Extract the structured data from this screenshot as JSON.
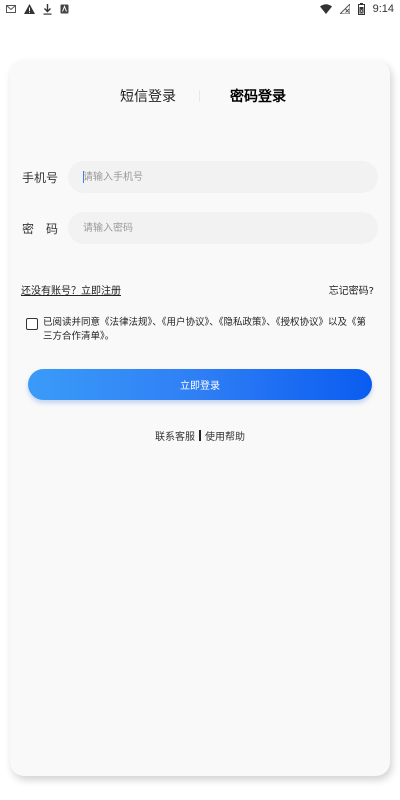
{
  "status_bar": {
    "time": "9:14",
    "left_icons": [
      "mail-icon",
      "warning-icon",
      "download-icon",
      "app-icon"
    ],
    "right_icons": [
      "wifi-icon",
      "no-signal-icon",
      "battery-icon"
    ]
  },
  "tabs": {
    "sms_login": "短信登录",
    "password_login": "密码登录"
  },
  "phone": {
    "label": "手机号",
    "placeholder": "请输入手机号",
    "value": ""
  },
  "password": {
    "label": "密　码",
    "placeholder": "请输入密码",
    "value": ""
  },
  "links": {
    "register": "还没有账号？立即注册",
    "forgot": "忘记密码?"
  },
  "agreement": {
    "checked": false,
    "text": "已阅读并同意《法律法规》、《用户协议》、《隐私政策》、《授权协议》以及《第三方合作清单》。"
  },
  "login_button": "立即登录",
  "help": {
    "contact": "联系客服",
    "help": "使用帮助"
  }
}
